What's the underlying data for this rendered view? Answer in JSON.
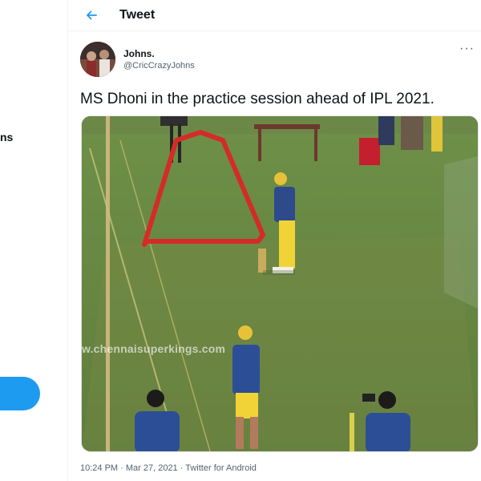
{
  "sidebar": {
    "fragment_text": "ns"
  },
  "header": {
    "title": "Tweet",
    "back_icon": "arrow-left-icon"
  },
  "tweet": {
    "author_name": "Johns.",
    "author_handle": "@CricCrazyJohns",
    "text": "MS Dhoni in the practice session ahead of IPL 2021.",
    "media_watermark": "w.chennaisuperkings.com",
    "timestamp": "10:24 PM · Mar 27, 2021 · Twitter for Android",
    "more_icon": "more-horizontal-icon"
  },
  "colors": {
    "accent": "#1d9bf0",
    "text": "#0f1419",
    "secondary": "#536471",
    "divider": "#eff3f4"
  }
}
